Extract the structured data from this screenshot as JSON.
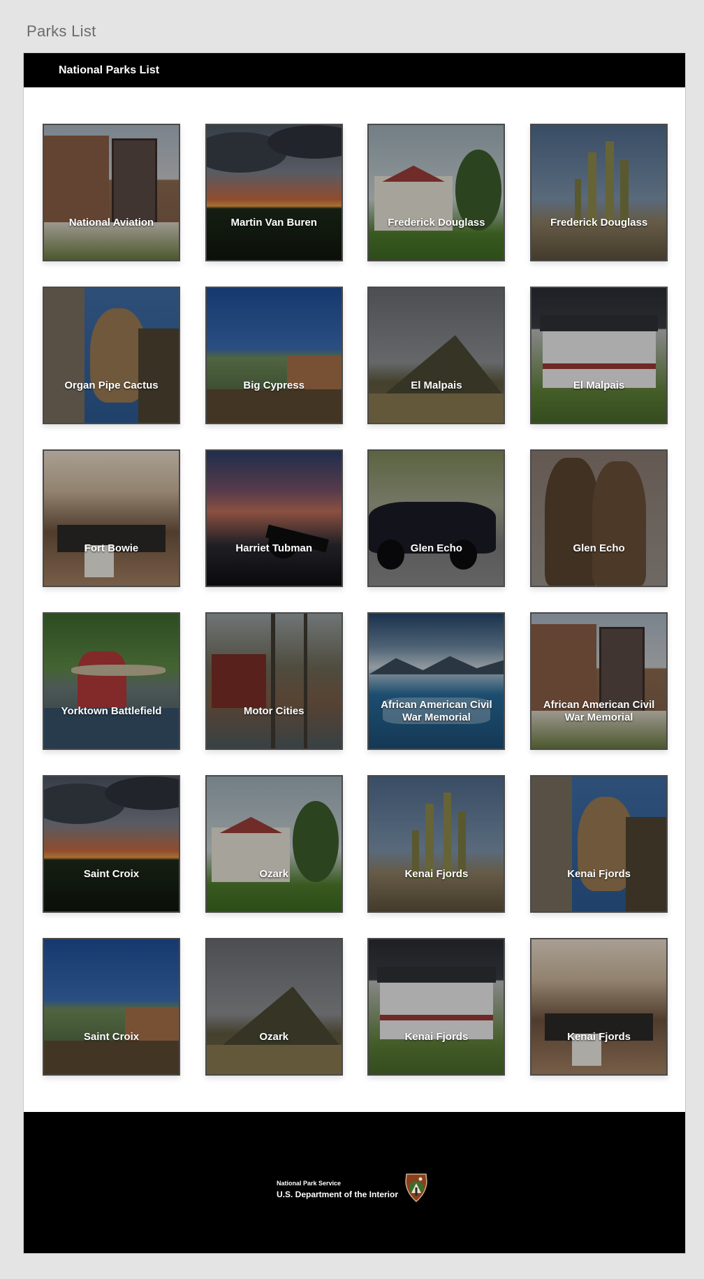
{
  "page": {
    "title": "Parks List"
  },
  "header": {
    "title": "National Parks List"
  },
  "parks": [
    {
      "name": "National Aviation",
      "scene": "building"
    },
    {
      "name": "Martin Van Buren",
      "scene": "sunset"
    },
    {
      "name": "Frederick Douglass",
      "scene": "house-lawn"
    },
    {
      "name": "Frederick Douglass",
      "scene": "cactus"
    },
    {
      "name": "Organ Pipe Cactus",
      "scene": "cougar"
    },
    {
      "name": "Big Cypress",
      "scene": "canyon"
    },
    {
      "name": "El Malpais",
      "scene": "mountain"
    },
    {
      "name": "El Malpais",
      "scene": "white-house"
    },
    {
      "name": "Fort Bowie",
      "scene": "hall"
    },
    {
      "name": "Harriet Tubman",
      "scene": "cannon"
    },
    {
      "name": "Glen Echo",
      "scene": "car"
    },
    {
      "name": "Glen Echo",
      "scene": "statue"
    },
    {
      "name": "Yorktown Battlefield",
      "scene": "fisherman"
    },
    {
      "name": "Motor Cities",
      "scene": "forest"
    },
    {
      "name": "African American Civil War Memorial",
      "scene": "glacier"
    },
    {
      "name": "African American Civil War Memorial",
      "scene": "building"
    },
    {
      "name": "Saint Croix",
      "scene": "sunset"
    },
    {
      "name": "Ozark",
      "scene": "house-lawn"
    },
    {
      "name": "Kenai Fjords",
      "scene": "cactus"
    },
    {
      "name": "Kenai Fjords",
      "scene": "cougar"
    },
    {
      "name": "Saint Croix",
      "scene": "canyon"
    },
    {
      "name": "Ozark",
      "scene": "mountain"
    },
    {
      "name": "Kenai Fjords",
      "scene": "white-house"
    },
    {
      "name": "Kenai Fjords",
      "scene": "hall"
    }
  ],
  "footer": {
    "agency": "National Park Service",
    "department": "U.S. Department of the Interior",
    "logo_icon": "nps-arrowhead-icon"
  }
}
